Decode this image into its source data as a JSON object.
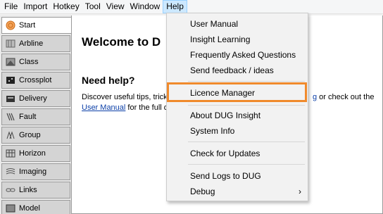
{
  "menubar": {
    "items": [
      "File",
      "Import",
      "Hotkey",
      "Tool",
      "View",
      "Window",
      "Help"
    ]
  },
  "sidebar": {
    "tabs": [
      {
        "label": "Start",
        "icon": "start-icon"
      },
      {
        "label": "Arbline",
        "icon": "arbline-icon"
      },
      {
        "label": "Class",
        "icon": "class-icon"
      },
      {
        "label": "Crossplot",
        "icon": "crossplot-icon"
      },
      {
        "label": "Delivery",
        "icon": "delivery-icon"
      },
      {
        "label": "Fault",
        "icon": "fault-icon"
      },
      {
        "label": "Group",
        "icon": "group-icon"
      },
      {
        "label": "Horizon",
        "icon": "horizon-icon"
      },
      {
        "label": "Imaging",
        "icon": "imaging-icon"
      },
      {
        "label": "Links",
        "icon": "links-icon"
      },
      {
        "label": "Model",
        "icon": "model-icon"
      }
    ]
  },
  "content": {
    "welcome_title": "Welcome to D",
    "need_help": "Need help?",
    "desc_line1": "Discover useful tips, trick",
    "desc_right_link": "g",
    "desc_right_text": " or check out the",
    "user_manual_link": "User Manual",
    "desc_line2_rest": " for the full d"
  },
  "help_menu": {
    "items": [
      {
        "label": "User Manual"
      },
      {
        "label": "Insight Learning"
      },
      {
        "label": "Frequently Asked Questions"
      },
      {
        "label": "Send feedback / ideas"
      },
      {
        "label": "Licence Manager"
      },
      {
        "label": "About DUG Insight"
      },
      {
        "label": "System Info"
      },
      {
        "label": "Check for Updates"
      },
      {
        "label": "Send Logs to DUG"
      },
      {
        "label": "Debug",
        "submenu_arrow": "›"
      }
    ]
  },
  "colors": {
    "highlight": "#f08a2c",
    "menu_open": "#cce8ff",
    "link": "#0b3fa8"
  }
}
